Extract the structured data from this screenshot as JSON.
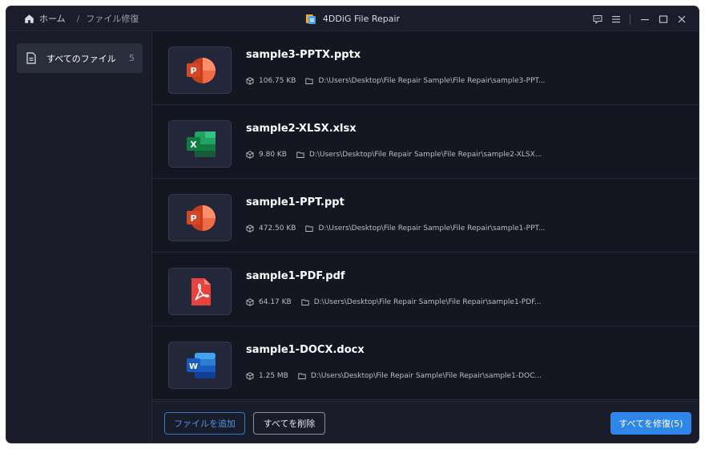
{
  "titlebar": {
    "home_label": "ホーム",
    "separator": "/",
    "current_label": "ファイル修復",
    "app_title": "4DDiG File Repair"
  },
  "sidebar": {
    "items": [
      {
        "label": "すべてのファイル",
        "count": "5",
        "icon": "file-icon"
      }
    ]
  },
  "files": [
    {
      "name": "sample3-PPTX.pptx",
      "size": "106.75 KB",
      "path": "D:\\Users\\Desktop\\File Repair Sample\\File Repair\\sample3-PPT...",
      "type": "powerpoint",
      "color": "#e8483d"
    },
    {
      "name": "sample2-XLSX.xlsx",
      "size": "9.80 KB",
      "path": "D:\\Users\\Desktop\\File Repair Sample\\File Repair\\sample2-XLSX...",
      "type": "excel",
      "color": "#1e9b5a"
    },
    {
      "name": "sample1-PPT.ppt",
      "size": "472.50 KB",
      "path": "D:\\Users\\Desktop\\File Repair Sample\\File Repair\\sample1-PPT...",
      "type": "powerpoint",
      "color": "#e8483d"
    },
    {
      "name": "sample1-PDF.pdf",
      "size": "64.17 KB",
      "path": "D:\\Users\\Desktop\\File Repair Sample\\File Repair\\sample1-PDF...",
      "type": "pdf",
      "color": "#e8433f"
    },
    {
      "name": "sample1-DOCX.docx",
      "size": "1.25 MB",
      "path": "D:\\Users\\Desktop\\File Repair Sample\\File Repair\\sample1-DOC...",
      "type": "word",
      "color": "#2f6fe3"
    }
  ],
  "footer": {
    "add_label": "ファイルを追加",
    "delete_label": "すべてを削除",
    "repair_label": "すべてを修復(5)"
  },
  "colors": {
    "accent": "#2e86e8",
    "background": "#141722",
    "sidebar": "#1a1d29"
  }
}
